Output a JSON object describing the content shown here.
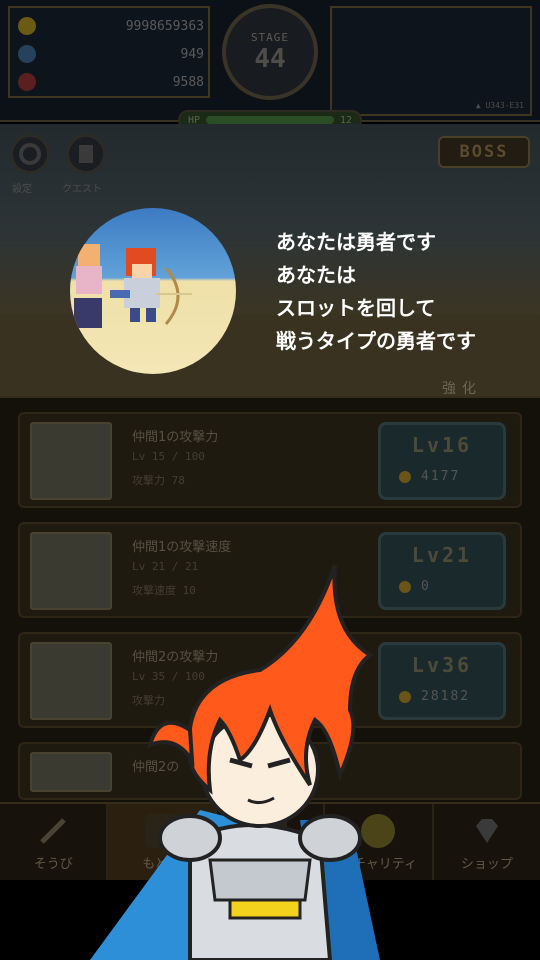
{
  "resources": [
    {
      "icon": "gold-coin-icon",
      "value": "9998659363",
      "color": "#6a5a14"
    },
    {
      "icon": "blue-gem-icon",
      "value": "949",
      "color": "#26425a"
    },
    {
      "icon": "red-stone-icon",
      "value": "9588",
      "color": "#5a2020"
    }
  ],
  "stage": {
    "label": "STAGE",
    "number": "44"
  },
  "version": "▲ U343-E31",
  "hp": {
    "label": "HP",
    "value": "12"
  },
  "scene_buttons": [
    {
      "label": "設定",
      "icon": "settings-icon"
    },
    {
      "label": "クエスト",
      "icon": "quest-icon"
    }
  ],
  "boss_button": "BOSS",
  "tab_label": "強化",
  "upgrades": [
    {
      "title": "仲間1の攻撃力",
      "line1": "Lv 15 / 100",
      "line2": "攻撃力 78",
      "level": "Lv16",
      "cost": "4177"
    },
    {
      "title": "仲間1の攻撃速度",
      "line1": "Lv 21 / 21",
      "line2": "攻撃速度 10",
      "level": "Lv21",
      "cost": "0"
    },
    {
      "title": "仲間2の攻撃力",
      "line1": "Lv 35 / 100",
      "line2": "攻撃力",
      "level": "Lv36",
      "cost": "28182"
    },
    {
      "title": "仲間2の",
      "line1": "",
      "line2": "",
      "level": "",
      "cost": ""
    }
  ],
  "nav": [
    {
      "label": "そうび",
      "icon": "sword-icon",
      "active": false
    },
    {
      "label": "もどる",
      "icon": "return-icon",
      "active": true
    },
    {
      "label": "",
      "icon": "hero-icon",
      "active": false
    },
    {
      "label": "ガチャリティ",
      "icon": "orb-icon",
      "active": false
    },
    {
      "label": "ショップ",
      "icon": "diamond-icon",
      "active": false
    }
  ],
  "tutorial": {
    "lines": [
      "あなたは勇者です",
      "あなたは",
      "スロットを回して",
      "戦うタイプの勇者です"
    ]
  },
  "colors": {
    "hero_hair": "#ff5a1c",
    "cape": "#2c8fd8",
    "overlay_text": "#ffffff"
  }
}
